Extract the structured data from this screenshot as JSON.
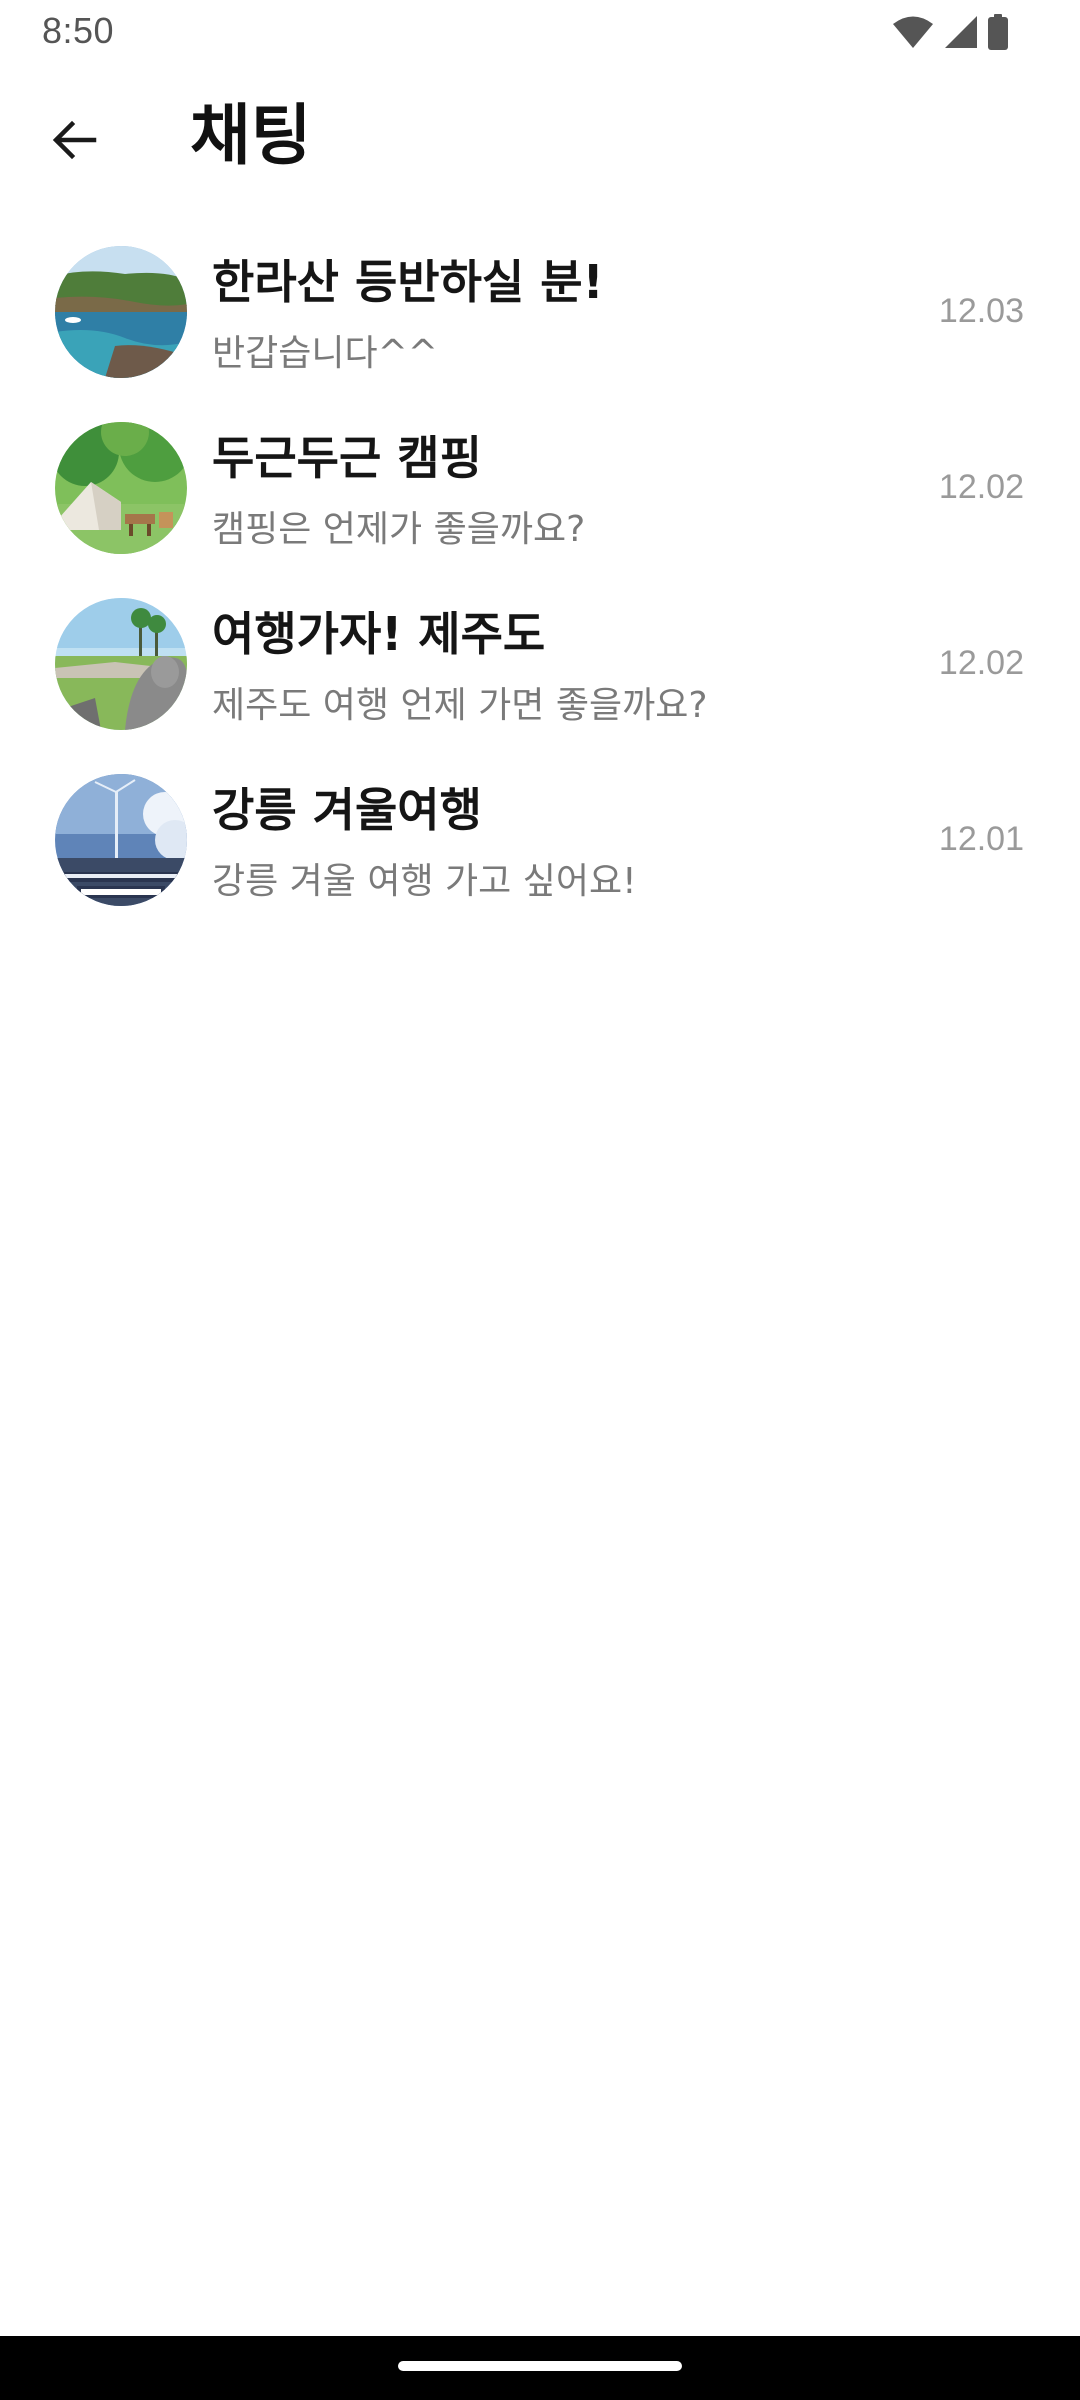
{
  "status_bar": {
    "time": "8:50",
    "icons": [
      "wifi-icon",
      "signal-icon",
      "battery-icon"
    ]
  },
  "header": {
    "title": "채팅",
    "back_icon": "arrow-left-icon"
  },
  "chats": [
    {
      "title": "한라산 등반하실 분!",
      "preview": "반갑습니다^^",
      "date": "12.03",
      "avatar": "coastal-cliff-photo"
    },
    {
      "title": "두근두근 캠핑",
      "preview": "캠핑은 언제가 좋을까요?",
      "date": "12.02",
      "avatar": "camping-tent-photo"
    },
    {
      "title": "여행가자! 제주도",
      "preview": "제주도 여행 언제 가면 좋을까요?",
      "date": "12.02",
      "avatar": "jeju-stone-statue-photo"
    },
    {
      "title": "강릉 겨울여행",
      "preview": "강릉 겨울 여행 가고 싶어요!",
      "date": "12.01",
      "avatar": "winter-snow-tree-photo"
    }
  ],
  "colors": {
    "title_text": "#111111",
    "preview_text": "#7a7a7a",
    "date_text": "#9a9a9a",
    "nav_bar": "#000000"
  }
}
